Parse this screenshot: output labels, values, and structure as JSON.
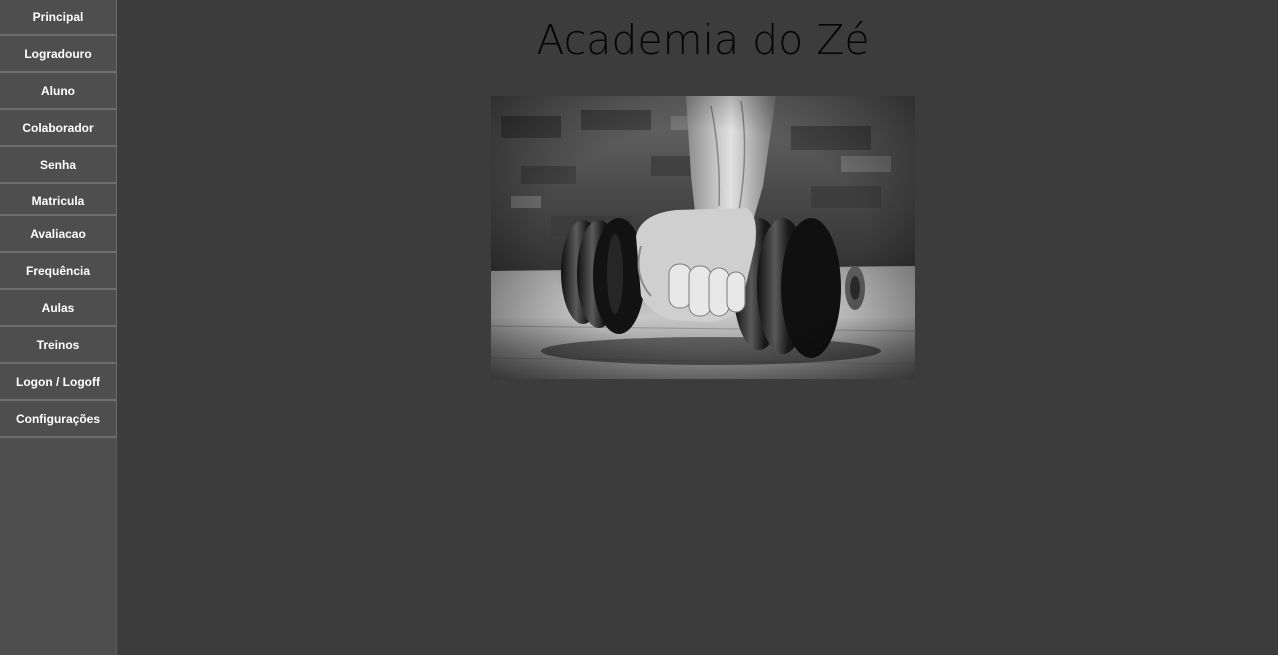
{
  "sidebar": {
    "items": [
      {
        "label": "Principal"
      },
      {
        "label": "Logradouro"
      },
      {
        "label": "Aluno"
      },
      {
        "label": "Colaborador"
      },
      {
        "label": "Senha"
      },
      {
        "label": "Matricula"
      },
      {
        "label": "Avaliacao"
      },
      {
        "label": "Frequência"
      },
      {
        "label": "Aulas"
      },
      {
        "label": "Treinos"
      },
      {
        "label": "Logon / Logoff"
      },
      {
        "label": "Configurações"
      }
    ]
  },
  "main": {
    "title": "Academia do Zé",
    "image": "dumbbell-hand-photo"
  },
  "colors": {
    "background": "#3b3c3b",
    "sidebar": "#4e4e4e",
    "nav_text": "#ffffff",
    "title_text": "#050505"
  }
}
